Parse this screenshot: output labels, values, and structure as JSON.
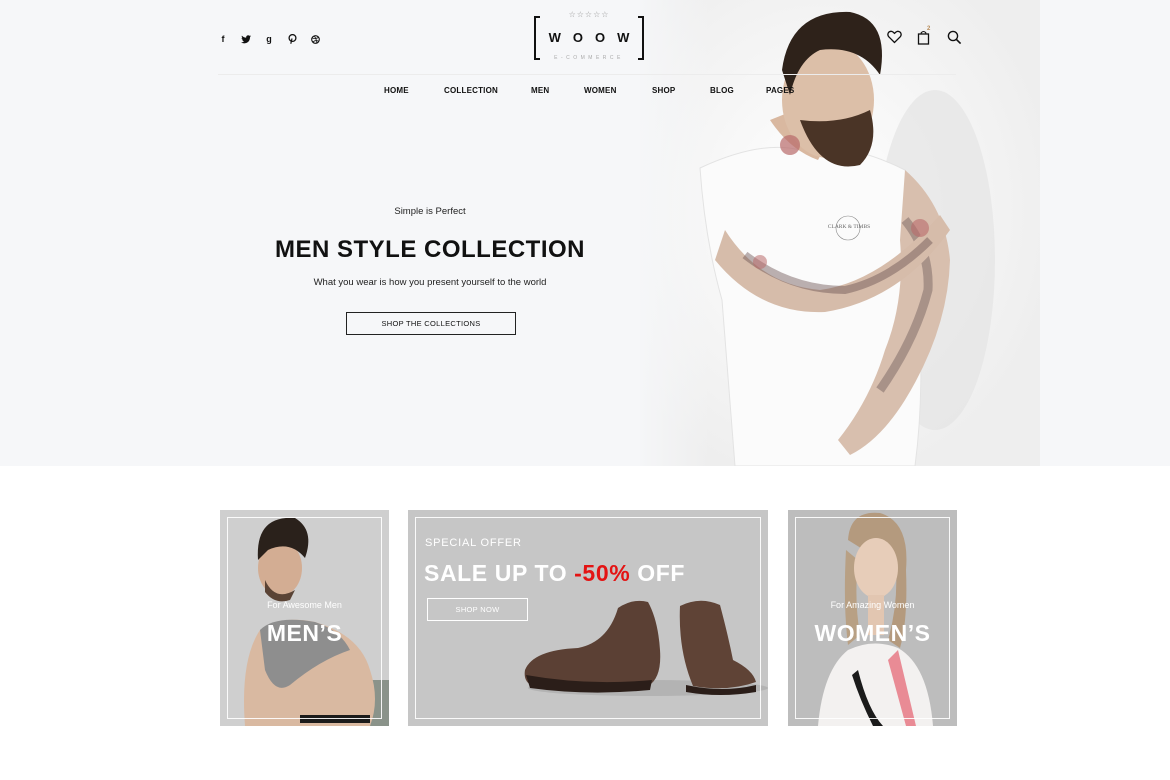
{
  "header": {
    "social": [
      {
        "icon": "facebook-icon",
        "glyph": "f"
      },
      {
        "icon": "twitter-icon",
        "glyph": "t"
      },
      {
        "icon": "google-plus-icon",
        "glyph": "g"
      },
      {
        "icon": "pinterest-icon",
        "glyph": "p"
      },
      {
        "icon": "dribbble-icon",
        "glyph": "d"
      }
    ],
    "logo": {
      "stars": "☆☆☆☆☆",
      "word": "WOOW",
      "sub": "E-COMMERCE"
    },
    "tools": {
      "wishlist_icon": "heart-icon",
      "cart_icon": "shopping-bag-icon",
      "cart_count": "2",
      "search_icon": "search-icon"
    }
  },
  "nav": {
    "items": [
      "HOME",
      "COLLECTION",
      "MEN",
      "WOMEN",
      "SHOP",
      "BLOG",
      "PAGES"
    ]
  },
  "hero": {
    "kicker": "Simple is Perfect",
    "title": "MEN STYLE COLLECTION",
    "tagline": "What you wear is how you present yourself to the world",
    "cta": "SHOP THE COLLECTIONS",
    "shirt_print": "CLARK & TIMBS"
  },
  "banners": {
    "men": {
      "small": "For Awesome Men",
      "big": "MEN’S"
    },
    "offer": {
      "special": "SPECIAL OFFER",
      "sale_prefix": "SALE UP TO ",
      "sale_pct": "-50%",
      "sale_suffix": " OFF",
      "button": "SHOP NOW"
    },
    "women": {
      "small": "For Amazing Women",
      "big": "WOMEN’S"
    }
  },
  "colors": {
    "accent_red": "#e41313",
    "hero_bg": "#f6f7f9",
    "text": "#111111"
  }
}
